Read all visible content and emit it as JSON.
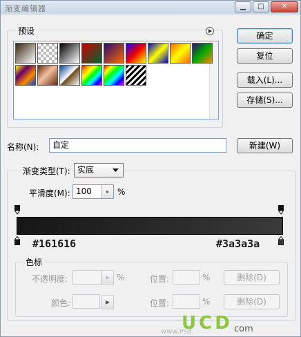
{
  "window": {
    "title": "渐变编辑器"
  },
  "presets": {
    "label": "预设",
    "swatches": [
      {
        "name": "brown-to-white",
        "css": "linear-gradient(135deg,#3a2814,#fff)"
      },
      {
        "name": "transparent",
        "css": "repeating-conic-gradient(#bbb 0% 25%,#fff 0% 50%) 0 0/8px 8px"
      },
      {
        "name": "black-to-white",
        "css": "linear-gradient(135deg,#000,#fff)"
      },
      {
        "name": "red-to-green",
        "css": "linear-gradient(135deg,#c00,#063)"
      },
      {
        "name": "violet-to-orange",
        "css": "linear-gradient(135deg,#2a0a6e,#ff6a00)"
      },
      {
        "name": "blue-red-yellow",
        "css": "linear-gradient(135deg,#10f,#e00 50%,#ff0)"
      },
      {
        "name": "blue-yellow-blue",
        "css": "linear-gradient(135deg,#00c,#ff0 50%,#00c)"
      },
      {
        "name": "orange-yellow-orange",
        "css": "linear-gradient(135deg,#f60,#ff0 50%,#f60)"
      },
      {
        "name": "violet-green-orange",
        "css": "linear-gradient(135deg,#2a0a6e,#0a0 50%,#f80)"
      },
      {
        "name": "yellow-violet-orange-blue",
        "css": "linear-gradient(135deg,#ff0,#606 33%,#f80 66%,#04c)"
      },
      {
        "name": "copper",
        "css": "linear-gradient(135deg,#6b2a12,#f0c0a0 45%,#6b2a12)"
      },
      {
        "name": "chrome",
        "css": "linear-gradient(135deg,#0a3e9a,#fff 48%,#6b4a1a 52%,#fff)"
      },
      {
        "name": "spectrum",
        "css": "linear-gradient(135deg,red,orange,yellow,lime,cyan,blue,magenta)"
      },
      {
        "name": "transparent-rainbow",
        "css": "linear-gradient(135deg,red,yellow,lime,cyan,blue,magenta)"
      },
      {
        "name": "transparent-stripes",
        "css": "repeating-linear-gradient(135deg,#000 0 3px,#fff 3px 6px)"
      }
    ]
  },
  "buttons": {
    "ok": "确定",
    "reset": "复位",
    "load": "载入(L)...",
    "save": "存储(S)...",
    "new": "新建(W)"
  },
  "name": {
    "label": "名称(N):",
    "value": "自定"
  },
  "gradient": {
    "type_label": "渐变类型(T):",
    "type_value": "实底",
    "smoothness_label": "平滑度(M):",
    "smoothness_value": "100",
    "smoothness_unit": "%",
    "left_hex": "#161616",
    "right_hex": "#3a3a3a",
    "colors": {
      "left": "#161616",
      "right": "#3a3a3a"
    }
  },
  "stops": {
    "label": "色标",
    "opacity_label": "不透明度:",
    "opacity_unit": "%",
    "color_label": "颜色:",
    "location_label": "位置:",
    "location_unit": "%",
    "delete": "删除(D)"
  },
  "watermark": {
    "logo": "UCD",
    "logo_suffix": "com",
    "site": "www.Psd"
  }
}
